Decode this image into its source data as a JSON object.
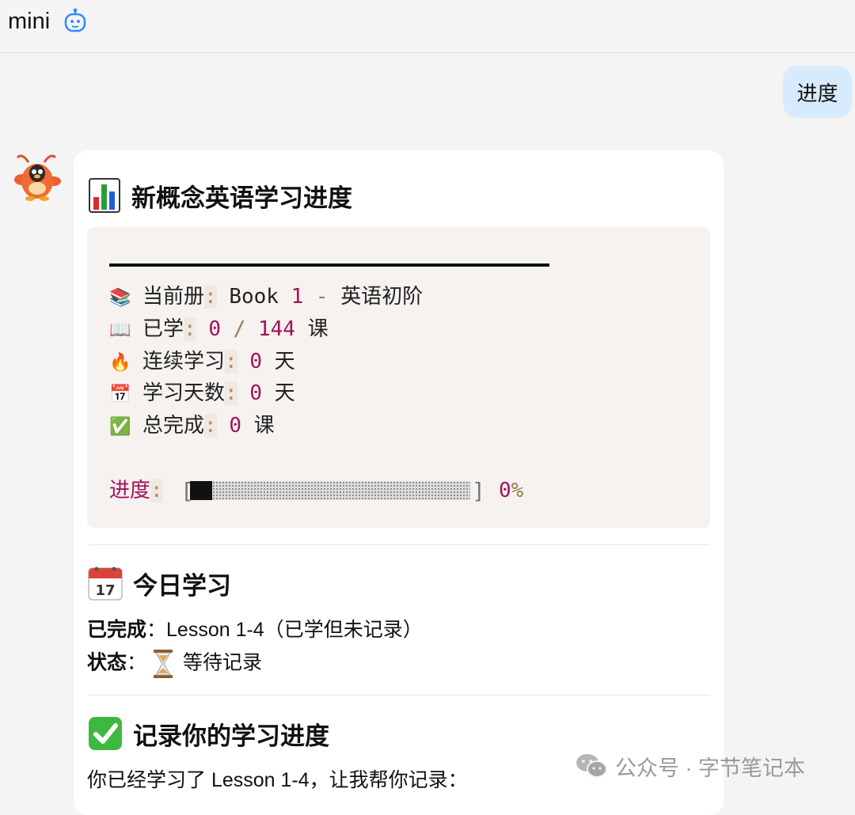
{
  "app": {
    "title": "mini",
    "icon": "robot-icon"
  },
  "user_message": {
    "text": "进度"
  },
  "reply": {
    "title": "新概念英语学习进度",
    "title_icon": "bar-chart-icon",
    "stats": [
      {
        "icon": "📚",
        "label": "当前册",
        "colon": ":",
        "parts": [
          {
            "t": "Book ",
            "c": "txt"
          },
          {
            "t": "1",
            "c": "num"
          },
          {
            "t": " - ",
            "c": "pun"
          },
          {
            "t": "英语初阶",
            "c": "txt"
          }
        ]
      },
      {
        "icon": "📖",
        "label": "已学",
        "colon": ":",
        "parts": [
          {
            "t": "0",
            "c": "num"
          },
          {
            "t": " / ",
            "c": "pun"
          },
          {
            "t": "144",
            "c": "num"
          },
          {
            "t": " 课",
            "c": "txt"
          }
        ]
      },
      {
        "icon": "🔥",
        "label": "连续学习",
        "colon": ":",
        "parts": [
          {
            "t": "0",
            "c": "num"
          },
          {
            "t": " 天",
            "c": "txt"
          }
        ]
      },
      {
        "icon": "📅",
        "label": "学习天数",
        "colon": ":",
        "parts": [
          {
            "t": "0",
            "c": "num"
          },
          {
            "t": " 天",
            "c": "txt"
          }
        ]
      },
      {
        "icon": "✅",
        "label": "总完成",
        "colon": ":",
        "parts": [
          {
            "t": "0",
            "c": "num"
          },
          {
            "t": " 课",
            "c": "txt"
          }
        ]
      }
    ],
    "progress": {
      "label": "进度",
      "colon": ":",
      "left_bracket": "[",
      "right_bracket": "]",
      "value": 0.08,
      "percent_num": "0",
      "percent_sign": "%"
    },
    "today": {
      "title": "今日学习",
      "icon": "calendar-icon",
      "completed_label": "已完成",
      "completed_value": "：Lesson 1-4（已学但未记录）",
      "status_label": "状态",
      "status_sep": "：",
      "status_value": "等待记录"
    },
    "record": {
      "title": "记录你的学习进度",
      "icon": "check-mark-icon",
      "text": "你已经学习了 Lesson 1-4，让我帮你记录："
    }
  },
  "watermark": {
    "text": "公众号 · 字节笔记本"
  },
  "colors": {
    "accent_blue": "#2f8cff",
    "user_bubble": "#d7ebfd",
    "number": "#a1125b",
    "check_green": "#3fb83f"
  }
}
